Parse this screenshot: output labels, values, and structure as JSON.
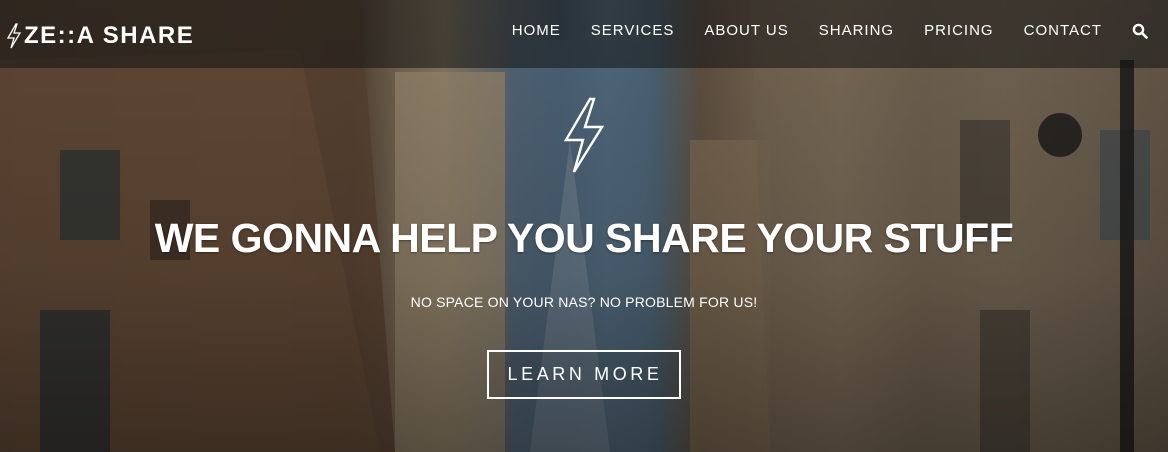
{
  "brand": {
    "name": "ZE::A SHARE",
    "icon": "lightning-bolt-icon"
  },
  "nav": {
    "items": [
      "HOME",
      "SERVICES",
      "ABOUT US",
      "SHARING",
      "PRICING",
      "CONTACT"
    ],
    "search_icon": "search-icon"
  },
  "hero": {
    "logo_icon": "lightning-bolt-icon",
    "headline": "WE GONNA HELP YOU SHARE YOUR STUFF",
    "subheadline": "NO SPACE ON YOUR NAS? NO PROBLEM FOR US!",
    "cta_label": "LEARN MORE"
  },
  "colors": {
    "text": "#ffffff",
    "navbar_overlay": "rgba(20,20,20,0.55)"
  }
}
